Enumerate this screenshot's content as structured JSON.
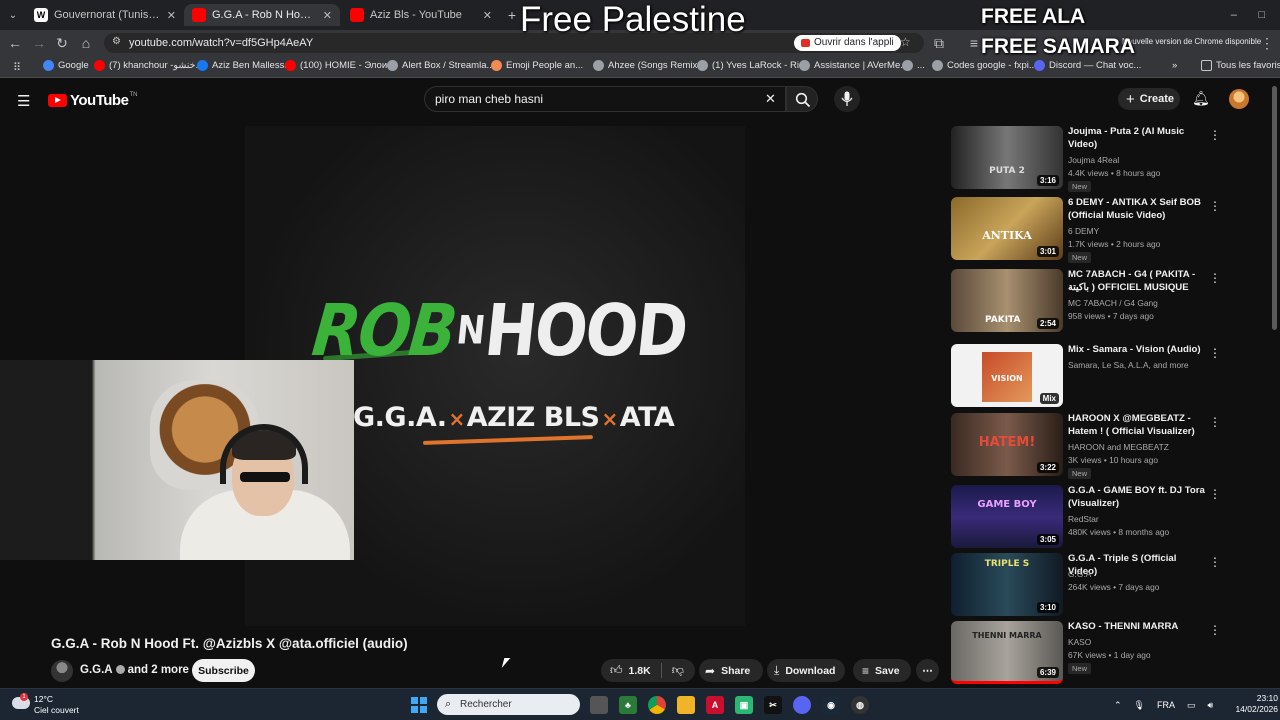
{
  "browser": {
    "tabs": [
      {
        "title": "Gouvernorat (Tunisie) — Wikipé",
        "favicon": "W"
      },
      {
        "title": "G.G.A - Rob N Hood Ft. @A",
        "favicon": "yt"
      },
      {
        "title": "Aziz Bls - YouTube",
        "favicon": "yt"
      }
    ],
    "url": "youtube.com/watch?v=df5GHp4AeAY",
    "open_in_app": "Ouvrir dans l'appli",
    "update_notice": "Nouvelle version de Chrome disponible",
    "bookmarks": [
      {
        "label": "Google",
        "color": "#4285f4"
      },
      {
        "label": "(7) khanchour -خنشو...",
        "color": "#ff0000"
      },
      {
        "label": "Aziz Ben Mallessa",
        "color": "#1877f2"
      },
      {
        "label": "(100) HOMIE - Элои...",
        "color": "#ff0000"
      },
      {
        "label": "Alert Box / Streamla...",
        "color": "#9aa0a6"
      },
      {
        "label": "Emoji People an...",
        "color": "#f28b50"
      },
      {
        "label": "Ahzee (Songs Remix...",
        "color": "#9aa0a6"
      },
      {
        "label": "(1) Yves LaRock - Ri...",
        "color": "#9aa0a6"
      },
      {
        "label": "Assistance | AVerMe...",
        "color": "#9aa0a6"
      },
      {
        "label": "...",
        "color": "#9aa0a6"
      },
      {
        "label": "Codes google - fxpi...",
        "color": "#9aa0a6"
      },
      {
        "label": "Discord — Chat voc...",
        "color": "#5865f2"
      }
    ],
    "all_favorites": "Tous les favoris"
  },
  "overlay": {
    "center": "Free Palestine",
    "right_line1": "FREE ALA",
    "right_line2": "FREE SAMARA"
  },
  "youtube": {
    "logo_text": "YouTube",
    "logo_sup": "TN",
    "search_value": "piro man cheb hasni",
    "create_label": "Create"
  },
  "video": {
    "art_title_rob": "ROB",
    "art_title_n": "N",
    "art_title_hood": "HOOD",
    "art_artist1": "G.G.A.",
    "art_artist2": "AZIZ BLS",
    "art_artist3": "ATA",
    "art_separator": "×",
    "title": "G.G.A - Rob N Hood Ft. @Azizbls X @ata.officiel (audio)",
    "channel": "G.G.A",
    "channel_more": "and 2 more",
    "subscribe": "Subscribe",
    "likes": "1.8K",
    "share": "Share",
    "download": "Download",
    "save": "Save"
  },
  "recommendations": [
    {
      "title": "Joujma - Puta 2 (AI Music Video)",
      "channel": "Joujma 4Real",
      "meta": "4.4K views • 8 hours ago",
      "duration": "3:16",
      "new": "New",
      "thumb_text": "PUTA 2"
    },
    {
      "title": "6 DEMY - ANTIKA X Seif BOB (Official Music Video)",
      "channel": "6 DEMY",
      "meta": "1.7K views • 2 hours ago",
      "duration": "3:01",
      "new": "New",
      "thumb_text": "ANTIKA"
    },
    {
      "title": "MC 7ABACH - G4 ( PAKITA - باكيتة ) OFFICIEL MUSIQUE CLIP",
      "channel": "MC 7ABACH / G4 Gang",
      "meta": "958 views • 7 days ago",
      "duration": "2:54",
      "new": "",
      "thumb_text": "PAKITA"
    },
    {
      "title": "Mix - Samara - Vision (Audio)",
      "channel": "Samara, Le Sa, A.L.A, and more",
      "meta": "",
      "duration": "Mix",
      "new": "",
      "thumb_text": "VISION"
    },
    {
      "title": "HAROON X @MEGBEATZ - Hatem ! ( Official Visualizer)",
      "channel": "HAROON and MEGBEATZ",
      "meta": "3K views • 10 hours ago",
      "duration": "3:22",
      "new": "New",
      "thumb_text": "HATEM!"
    },
    {
      "title": "G.G.A - GAME BOY ft. DJ Tora (Visualizer)",
      "channel": "RedStar",
      "meta": "480K views • 8 months ago",
      "duration": "3:05",
      "new": "",
      "thumb_text": "GAME BOY"
    },
    {
      "title": "G.G.A - Triple S (Official Video)",
      "channel": "G.G.A",
      "meta": "264K views • 7 days ago",
      "duration": "3:10",
      "new": "",
      "thumb_text": "TRIPLE S"
    },
    {
      "title": "KASO - THENNI MARRA",
      "channel": "KASO",
      "meta": "67K views • 1 day ago",
      "duration": "6:39",
      "new": "New",
      "thumb_text": "THENNI MARRA"
    }
  ],
  "taskbar": {
    "weather_temp": "12°C",
    "weather_desc": "Ciel couvert",
    "weather_badge": "1",
    "search_placeholder": "Rechercher",
    "lang": "FRA",
    "time": "23:10",
    "date": "14/02/2026"
  }
}
